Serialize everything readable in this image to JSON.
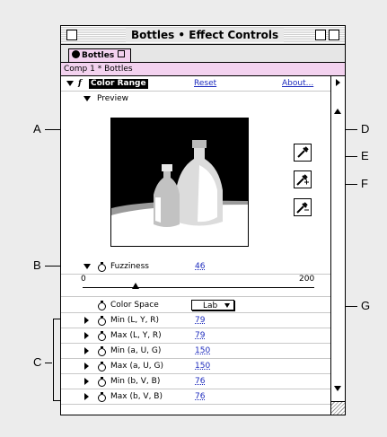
{
  "window": {
    "title": "Bottles • Effect Controls",
    "tab_label": "Bottles",
    "comp_label": "Comp 1 * Bottles"
  },
  "effect": {
    "name": "Color Range",
    "reset_label": "Reset",
    "about_label": "About...",
    "fx_symbol": "f"
  },
  "preview": {
    "label": "Preview"
  },
  "fuzziness": {
    "label": "Fuzziness",
    "value": "46",
    "slider_min": "0",
    "slider_max": "200",
    "slider_fraction": 0.23
  },
  "color_space": {
    "label": "Color Space",
    "value": "Lab"
  },
  "params": [
    {
      "label": "Min (L, Y, R)",
      "value": "79"
    },
    {
      "label": "Max (L, Y, R)",
      "value": "79"
    },
    {
      "label": "Min (a, U, G)",
      "value": "150"
    },
    {
      "label": "Max (a, U, G)",
      "value": "150"
    },
    {
      "label": "Min (b, V, B)",
      "value": "76"
    },
    {
      "label": "Max (b, V, B)",
      "value": "76"
    }
  ],
  "callouts": {
    "A": "A",
    "B": "B",
    "C": "C",
    "D": "D",
    "E": "E",
    "F": "F",
    "G": "G"
  },
  "icons": [
    "eyedropper-icon",
    "eyedropper-plus-icon",
    "eyedropper-minus-icon",
    "stopwatch-icon",
    "disclosure-triangle-icon",
    "panel-menu-arrow-icon"
  ]
}
